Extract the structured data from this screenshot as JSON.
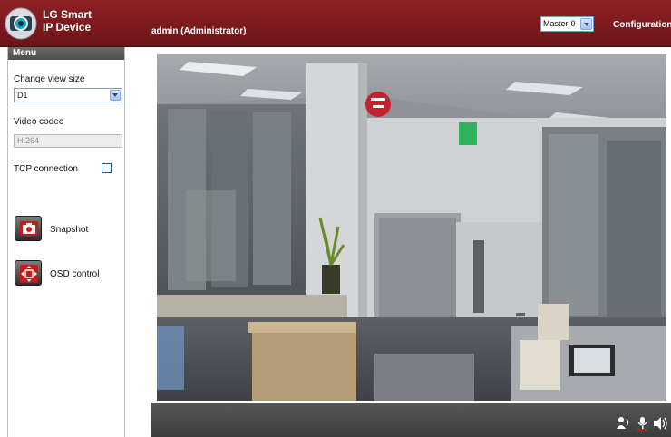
{
  "header": {
    "brand_line1": "LG Smart",
    "brand_line2": "IP Device",
    "user": "admin (Administrator)",
    "stream_select": {
      "value": "Master-0"
    },
    "config_link": "Configuration"
  },
  "sidebar": {
    "title": "Menu",
    "view_size_label": "Change view size",
    "view_size_value": "D1",
    "codec_label": "Video codec",
    "codec_value": "H.264",
    "tcp_label": "TCP connection",
    "tcp_checked": false,
    "snapshot_label": "Snapshot",
    "osd_label": "OSD control"
  },
  "icons": {
    "logo": "camera-logo-icon",
    "snapshot": "camera-icon",
    "osd": "osd-arrows-icon",
    "talk": "talk-icon",
    "mic": "microphone-icon",
    "speaker": "speaker-icon"
  },
  "colors": {
    "header_red": "#7a1a1e",
    "menu_bar": "#555555",
    "control_bar": "#454545",
    "accent_red": "#cc1a1a"
  }
}
